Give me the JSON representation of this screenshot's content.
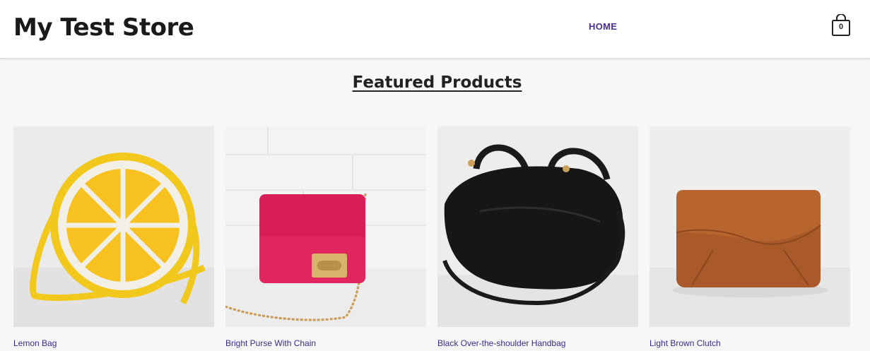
{
  "header": {
    "store_name": "My Test Store",
    "nav": [
      {
        "label": "HOME"
      }
    ],
    "cart_count": "0"
  },
  "featured": {
    "title": "Featured Products",
    "products": [
      {
        "title": "Lemon Bag",
        "image_icon": "lemon-bag-image"
      },
      {
        "title": "Bright Purse With Chain",
        "image_icon": "pink-purse-image"
      },
      {
        "title": "Black Over-the-shoulder Handbag",
        "image_icon": "black-handbag-image"
      },
      {
        "title": "Light Brown Clutch",
        "image_icon": "brown-clutch-image"
      }
    ]
  },
  "colors": {
    "nav_link": "#4b2f8f",
    "product_link": "#3b2a8a",
    "page_bg": "#f7f7f7"
  }
}
